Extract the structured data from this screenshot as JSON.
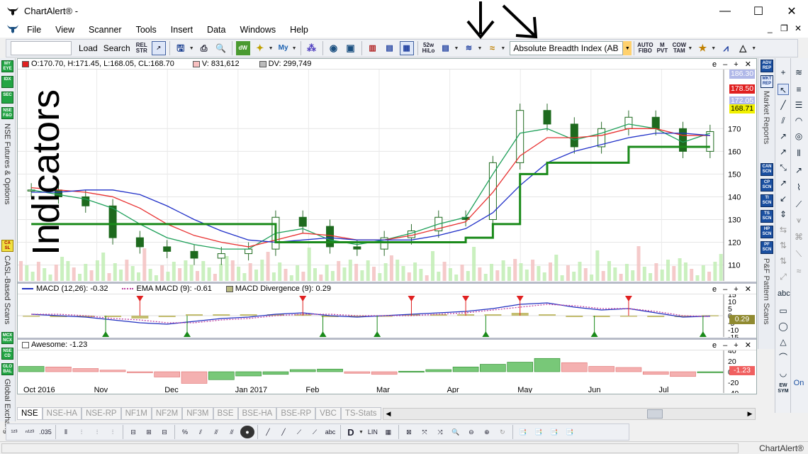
{
  "window": {
    "title": "ChartAlert® -",
    "controls": {
      "minimize": "—",
      "maximize": "☐",
      "close": "✕"
    },
    "mdi_controls": {
      "minimize": "_",
      "restore": "❐",
      "close": "✕"
    }
  },
  "menu": [
    "File",
    "View",
    "Scanner",
    "Tools",
    "Insert",
    "Data",
    "Windows",
    "Help"
  ],
  "toolbar": {
    "load_label": "Load",
    "search_label": "Search",
    "symbol_value": "",
    "indicator_selected": "Absolute Breadth Index (AB",
    "buttons": [
      {
        "name": "rel-str",
        "label": "REL STR"
      },
      {
        "name": "52w-hilo",
        "label": "52w HiLo"
      },
      {
        "name": "auto-fibo",
        "label": "AUTO FIBO"
      },
      {
        "name": "m-pvt",
        "label": "M PVT"
      },
      {
        "name": "cow-tam",
        "label": "COW TAM"
      }
    ]
  },
  "left_sidebar": {
    "buttons": [
      "MY EYE",
      "IDX",
      "SEC",
      "NSE F&O",
      "CA SL",
      "MCX NCX",
      "NSE CD",
      "GLO BAL"
    ],
    "vertical_labels": [
      "NSE Futures & Options",
      "CASL-Based Scans",
      "Global Exchang"
    ]
  },
  "right_sidebar": {
    "buttons": [
      "ADV REP",
      "MKT REP",
      "CAN SCN",
      "CP SCN",
      "TI SCN",
      "TS SCN",
      "HP SCN",
      "PF SCN"
    ],
    "vertical_labels": [
      "Market Reports",
      "P&F Pattern Scans"
    ],
    "bottom_labels": [
      "On",
      "EW SYM"
    ]
  },
  "chart_panes": {
    "price": {
      "ohlc": "O:170.70, H:171.45, L:168.05, CL:168.70",
      "volume": "V: 831,612",
      "dv": "DV: 299,749",
      "price_labels": [
        {
          "value": "186.30",
          "color": "#b0b8e8",
          "text_color": "#fff"
        },
        {
          "value": "178.50",
          "color": "#e02020",
          "text_color": "#fff"
        },
        {
          "value": "172.05",
          "color": "#b0b8e8",
          "text_color": "#fff"
        },
        {
          "value": "168.71",
          "color": "#f0f000",
          "text_color": "#000"
        }
      ]
    },
    "macd": {
      "macd_label": "MACD (12,26): -0.32",
      "ema_label": "EMA MACD (9): -0.61",
      "div_label": "MACD Divergence (9): 0.29",
      "value_label": "0.29"
    },
    "awesome": {
      "label": "Awesome: -1.23",
      "value_label": "-1.23"
    },
    "pane_controls": "e – + ✕"
  },
  "chart_data": [
    {
      "type": "line",
      "title": "",
      "x": [
        "Oct 2016",
        "Nov",
        "Dec",
        "Jan 2017",
        "Feb",
        "Mar",
        "Apr",
        "May",
        "Jun",
        "Jul"
      ],
      "y_ticks": [
        110,
        120,
        130,
        140,
        150,
        160,
        170
      ],
      "ylim": [
        103,
        196
      ],
      "close": [
        143,
        140,
        136,
        122,
        118,
        116,
        113,
        115,
        117,
        131,
        127,
        118,
        117,
        122,
        125,
        131,
        130,
        155,
        178,
        172,
        162,
        170,
        175,
        170,
        160,
        168.7
      ],
      "series": [
        {
          "values": [
            143,
            141,
            139,
            135,
            128,
            122,
            119,
            117,
            117,
            124,
            126,
            121,
            119,
            121,
            124,
            128,
            131,
            150,
            168,
            170,
            165,
            168,
            172,
            170,
            164,
            168
          ]
        },
        {
          "values": [
            144,
            143,
            142,
            140,
            135,
            128,
            123,
            120,
            118,
            121,
            124,
            123,
            121,
            121,
            123,
            126,
            129,
            142,
            158,
            166,
            166,
            167,
            170,
            170,
            167,
            167
          ]
        },
        {
          "values": [
            142,
            142,
            143,
            143,
            141,
            136,
            130,
            125,
            121,
            120,
            121,
            122,
            121,
            121,
            121,
            123,
            126,
            133,
            145,
            155,
            160,
            163,
            166,
            168,
            168,
            167
          ]
        },
        {
          "values": [
            128,
            128,
            128,
            128,
            128,
            128,
            128,
            128,
            128,
            120,
            120,
            120,
            120,
            120,
            120,
            120,
            122,
            128,
            150,
            155,
            155,
            155,
            162,
            162,
            162,
            162
          ]
        }
      ]
    },
    {
      "type": "line",
      "title": "",
      "y_ticks": [
        -15,
        -10,
        -5,
        0,
        5,
        10,
        15
      ],
      "ylim": [
        -15,
        15
      ],
      "series": [
        {
          "values": [
            1,
            0,
            -1,
            -3,
            -5,
            -6,
            -4,
            -2,
            -1,
            1,
            2,
            0,
            -1,
            0,
            1,
            2,
            3,
            5,
            8,
            9,
            6,
            4,
            5,
            2,
            -1,
            -0.32
          ]
        },
        {
          "values": [
            1,
            1,
            0,
            -2,
            -3,
            -5,
            -5,
            -3,
            -2,
            0,
            1,
            1,
            0,
            0,
            0,
            1,
            2,
            4,
            6,
            8,
            7,
            5,
            5,
            3,
            0,
            -0.61
          ]
        }
      ]
    },
    {
      "type": "bar",
      "title": "",
      "y_ticks": [
        -40,
        -20,
        0,
        20,
        40
      ],
      "ylim": [
        -40,
        40
      ],
      "values": [
        10,
        9,
        6,
        3,
        -2,
        -10,
        -22,
        -15,
        -8,
        -5,
        4,
        5,
        -3,
        -5,
        1,
        4,
        9,
        14,
        18,
        25,
        17,
        10,
        8,
        -5,
        -9,
        -1.23
      ]
    }
  ],
  "tabs": [
    "NSE",
    "NSE-HA",
    "NSE-RP",
    "NF1M",
    "NF2M",
    "NF3M",
    "BSE",
    "BSE-HA",
    "BSE-RP",
    "VBC",
    "TS-Stats"
  ],
  "overlay": {
    "text": "Indicators"
  },
  "status": {
    "text": "ChartAlert®"
  },
  "bottom_toolbar": {
    "lin_label": "LIN",
    "d_label": "D"
  }
}
